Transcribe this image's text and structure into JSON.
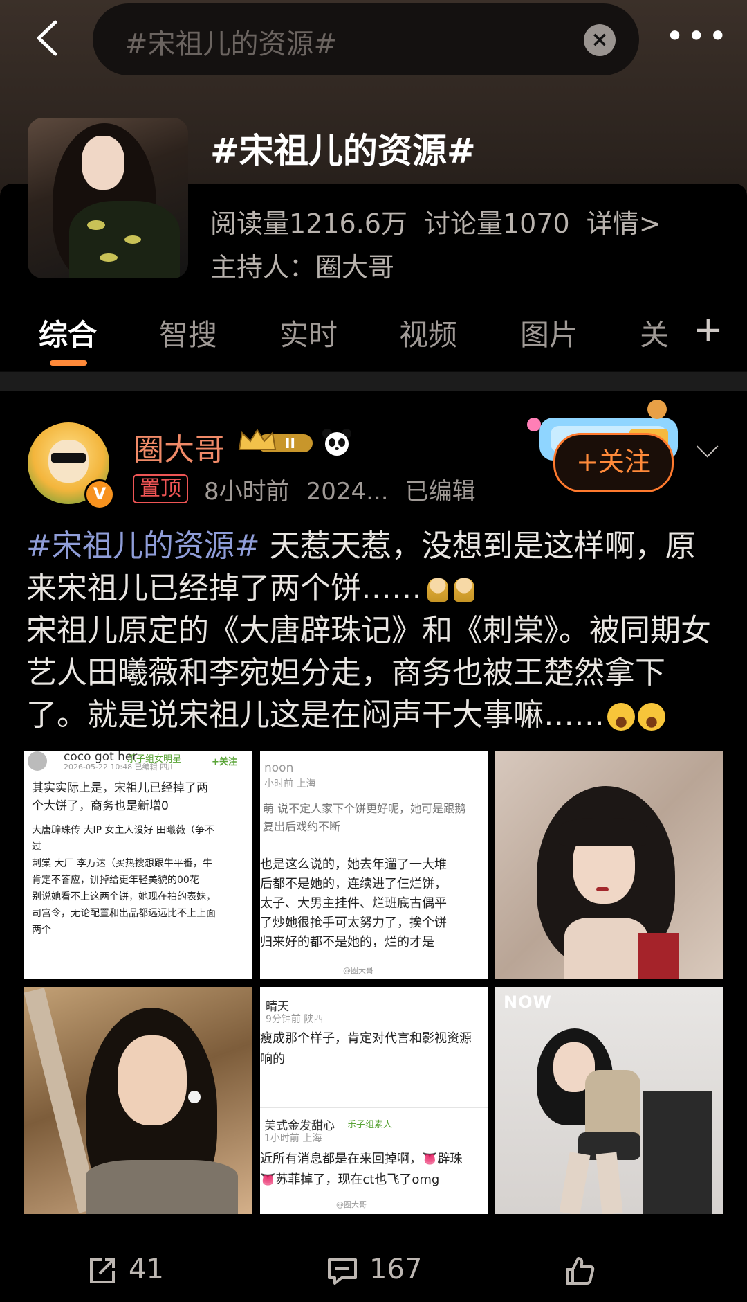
{
  "search": {
    "query": "#宋祖儿的资源#"
  },
  "topic": {
    "title": "#宋祖儿的资源#",
    "reads": "阅读量1216.6万",
    "discussions": "讨论量1070",
    "detail_link": "详情>",
    "host": "主持人：圈大哥"
  },
  "tabs": [
    "综合",
    "智搜",
    "实时",
    "视频",
    "图片",
    "关"
  ],
  "post": {
    "username": "圈大哥",
    "pin_label": "置顶",
    "time": "8小时前",
    "date": "2024...",
    "edited": "已编辑",
    "follow_label": "+关注",
    "hashtag": "#宋祖儿的资源#",
    "line1": " 天惹天惹，没想到是这样啊，原来宋祖儿已经掉了两个饼……",
    "para2": "宋祖儿原定的《大唐辟珠记》和《刺棠》。被同期女艺人田曦薇和李宛妲分走，商务也被王楚然拿下了。就是说宋祖儿这是在闷声干大事嘛……"
  },
  "images": {
    "img1": {
      "user": "coco got her",
      "tag": "乐子组女明星",
      "meta": "2026-05-22 10:48 已编辑 四川",
      "follow": "+关注",
      "lines": [
        "其实实际上是，宋祖儿已经掉了两",
        "个大饼了，商务也是新增0",
        "",
        "大唐辟珠传 大IP 女主人设好 田曦薇（争不",
        "过",
        "刺棠 大厂 李万达（买热搜想跟牛平番，牛",
        "肯定不答应，饼掉给更年轻美貌的00花",
        "别说她看不上这两个饼，她现在拍的表妹，",
        "司宫令，无论配置和出品都远远比不上上面",
        "两个"
      ]
    },
    "img2": {
      "user": "noon",
      "meta": "小时前 上海",
      "lines": [
        "萌 说不定人家下个饼更好呢，她可是跟鹅",
        "复出后戏约不断",
        "",
        "也是这么说的，她去年遛了一大堆",
        "后都不是她的，连续进了仨烂饼，",
        "太子、大男主挂件、烂班底古偶平",
        "了炒她很抢手可太努力了，挨个饼",
        "归来好的都不是她的，烂的才是"
      ],
      "watermark": "@圈大哥"
    },
    "img5": {
      "user1": "晴天",
      "meta1": "9分钟前 陕西",
      "lines1": [
        "瘦成那个样子，肯定对代言和影视资源",
        "响的"
      ],
      "user2": "美式金发甜心",
      "tag2": "乐子组素人",
      "meta2": "1小时前 上海",
      "lines2": [
        "近所有消息都是在来回掉啊，👅辟珠",
        "👅苏菲掉了，现在ct也飞了omg"
      ],
      "watermark": "@圈大哥"
    },
    "img6": {
      "logo": "NOW"
    }
  },
  "actions": {
    "reposts": "41",
    "comments": "167"
  }
}
